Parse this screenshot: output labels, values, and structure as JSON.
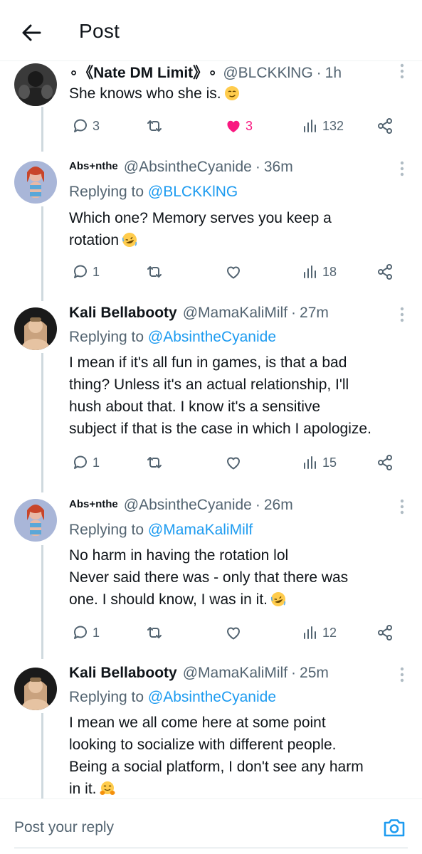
{
  "header": {
    "title": "Post"
  },
  "tweets": [
    {
      "display_name": "∘《Nate DM Limit》∘",
      "handle": "@BLCKKlNG",
      "time": "1h",
      "replying_label": "",
      "replying_to": "",
      "lines": [
        "She knows who she is."
      ],
      "emoji": "smirk-emoji",
      "replies": "3",
      "reposts": "",
      "likes": "3",
      "liked": true,
      "views": "132"
    },
    {
      "display_name": "Abs+nthe",
      "handle": "@AbsintheCyanide",
      "time": "36m",
      "replying_label": "Replying to",
      "replying_to": "@BLCKKlNG",
      "lines": [
        "Which one? Memory serves you keep a",
        "rotation"
      ],
      "emoji": "rofl-emoji",
      "replies": "1",
      "reposts": "",
      "likes": "",
      "liked": false,
      "views": "18"
    },
    {
      "display_name": "Kali Bellabooty",
      "handle": "@MamaKaliMilf",
      "time": "27m",
      "replying_label": "Replying to",
      "replying_to": "@AbsintheCyanide",
      "lines": [
        "I mean if it's all fun in games, is that a bad",
        "thing? Unless it's an actual relationship, I'll",
        "hush about that. I know it's a sensitive",
        "subject if that is the case in which I apologize."
      ],
      "emoji": "",
      "replies": "1",
      "reposts": "",
      "likes": "",
      "liked": false,
      "views": "15"
    },
    {
      "display_name": "Abs+nthe",
      "handle": "@AbsintheCyanide",
      "time": "26m",
      "replying_label": "Replying to",
      "replying_to": "@MamaKaliMilf",
      "lines": [
        "No harm in having the rotation lol",
        "Never said there was - only that there was",
        "one. I should know, I was in it."
      ],
      "emoji": "rofl-emoji",
      "replies": "1",
      "reposts": "",
      "likes": "",
      "liked": false,
      "views": "12"
    },
    {
      "display_name": "Kali Bellabooty",
      "handle": "@MamaKaliMilf",
      "time": "25m",
      "replying_label": "Replying to",
      "replying_to": "@AbsintheCyanide",
      "lines": [
        "I mean we all come here at some point",
        "looking to socialize with different people.",
        "Being a social platform, I don't see any harm",
        "in it."
      ],
      "emoji": "hugging-emoji",
      "replies": "",
      "reposts": "",
      "likes": "",
      "liked": false,
      "views": ""
    }
  ],
  "compose": {
    "placeholder": "Post your reply"
  },
  "colors": {
    "accent": "#1d9bf0",
    "like": "#f91880",
    "muted": "#536471",
    "thread_line": "#cfd9de"
  }
}
